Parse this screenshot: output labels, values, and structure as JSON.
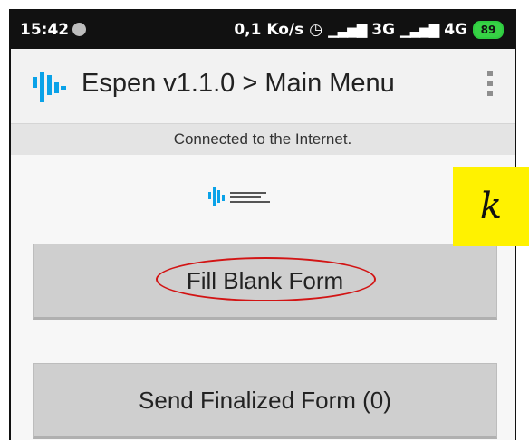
{
  "status_bar": {
    "time": "15:42",
    "network_speed": "0,1 Ko/s",
    "signal_3g": "3G",
    "signal_4g": "4G",
    "battery": "89",
    "icons": [
      "alarm-icon",
      "signal-icon",
      "battery-icon"
    ]
  },
  "action_bar": {
    "title": "Espen v1.1.0 > Main Menu",
    "icons": [
      "app-logo-icon",
      "overflow-menu-icon"
    ],
    "logo_color": "#0aa2e8"
  },
  "notice": {
    "text": "Connected to the Internet."
  },
  "main": {
    "fill_blank_label": "Fill Blank Form",
    "send_finalized_label": "Send Finalized Form (0)"
  },
  "annotation": {
    "tag": "k",
    "highlight_color": "#d21414",
    "tag_color": "#fff200"
  }
}
